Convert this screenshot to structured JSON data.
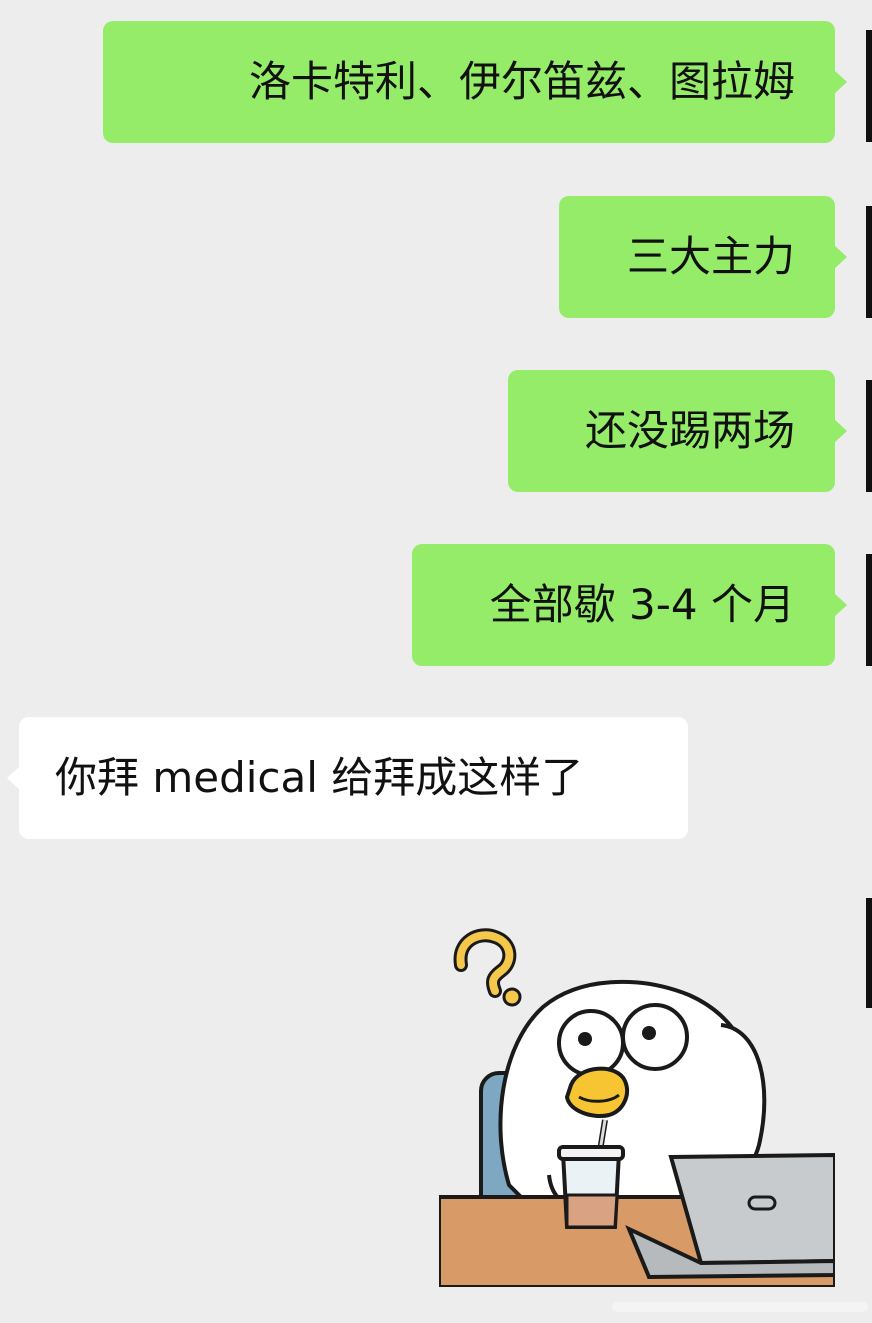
{
  "messages": [
    {
      "direction": "outgoing",
      "text": "洛卡特利、伊尔笛兹、图拉姆"
    },
    {
      "direction": "outgoing",
      "text": "三大主力"
    },
    {
      "direction": "outgoing",
      "text": "还没踢两场"
    },
    {
      "direction": "outgoing",
      "text": "全部歇 3-4 个月"
    },
    {
      "direction": "incoming",
      "text": "你拜 medical 给拜成这样了"
    }
  ],
  "sticker": {
    "description_icon": "confused-duck-drinking-at-laptop-sticker",
    "symbol": "?"
  },
  "colors": {
    "background": "#ededed",
    "outgoing_bubble": "#95ec69",
    "incoming_bubble": "#ffffff",
    "text": "#111111"
  }
}
